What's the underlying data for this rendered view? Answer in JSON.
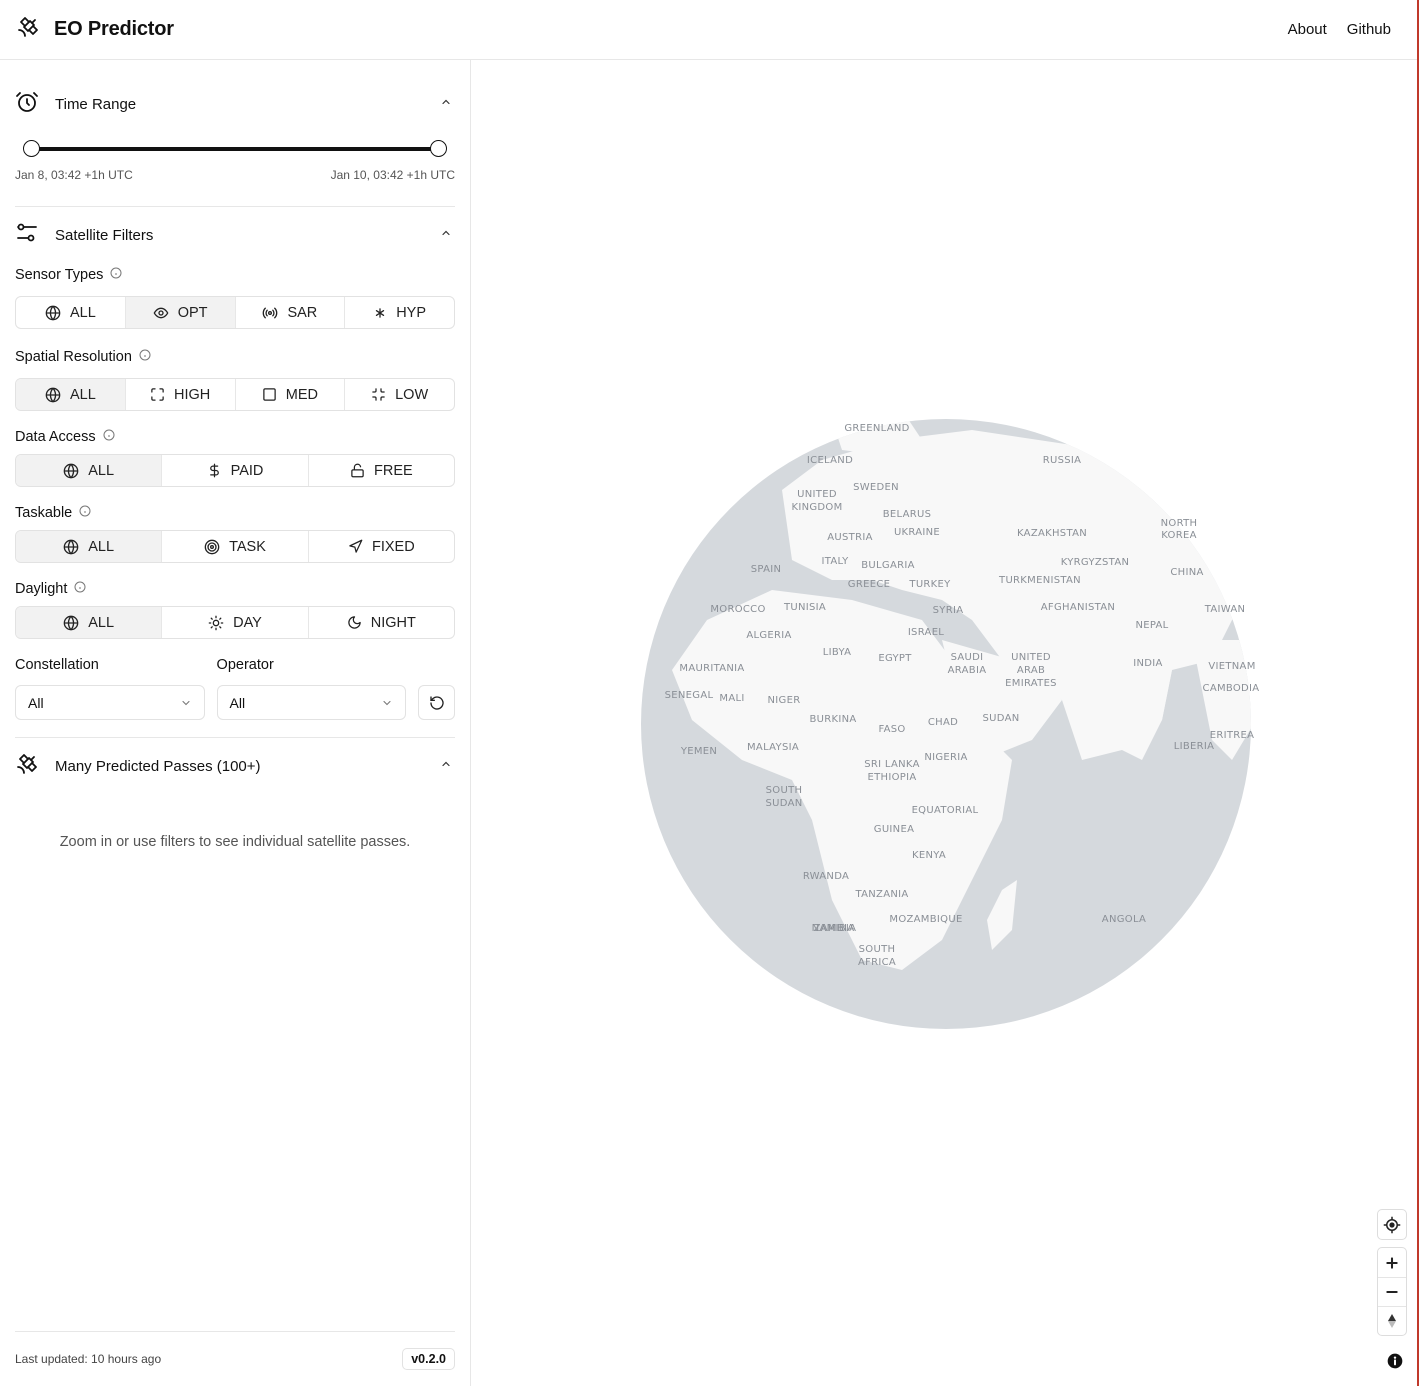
{
  "header": {
    "title": "EO Predictor",
    "nav": {
      "about": "About",
      "github": "Github"
    }
  },
  "time_range": {
    "title": "Time Range",
    "start_label": "Jan 8, 03:42 +1h UTC",
    "end_label": "Jan 10, 03:42 +1h UTC",
    "start_fraction": 0.0,
    "end_fraction": 1.0
  },
  "filters": {
    "title": "Satellite Filters",
    "sensor_types": {
      "label": "Sensor Types",
      "options": [
        "ALL",
        "OPT",
        "SAR",
        "HYP"
      ],
      "active": "OPT"
    },
    "spatial_resolution": {
      "label": "Spatial Resolution",
      "options": [
        "ALL",
        "HIGH",
        "MED",
        "LOW"
      ],
      "active": "ALL"
    },
    "data_access": {
      "label": "Data Access",
      "options": [
        "ALL",
        "PAID",
        "FREE"
      ],
      "active": "ALL"
    },
    "taskable": {
      "label": "Taskable",
      "options": [
        "ALL",
        "TASK",
        "FIXED"
      ],
      "active": "ALL"
    },
    "daylight": {
      "label": "Daylight",
      "options": [
        "ALL",
        "DAY",
        "NIGHT"
      ],
      "active": "ALL"
    },
    "constellation": {
      "label": "Constellation",
      "value": "All"
    },
    "operator": {
      "label": "Operator",
      "value": "All"
    }
  },
  "passes": {
    "title": "Many Predicted Passes (100+)",
    "hint": "Zoom in or use filters to see individual satellite passes."
  },
  "footer": {
    "last_updated": "Last updated: 10 hours ago",
    "version": "v0.2.0"
  },
  "map": {
    "labels": [
      "GREENLAND",
      "ICELAND",
      "RUSSIA",
      "UNITED",
      "KINGDOM",
      "SWEDEN",
      "BELARUS",
      "UKRAINE",
      "AUSTRIA",
      "KAZAKHSTAN",
      "NORTH",
      "KOREA",
      "KYRGYZSTAN",
      "SPAIN",
      "ITALY",
      "BULGARIA",
      "TURKMENISTAN",
      "CHINA",
      "GREECE",
      "TURKEY",
      "MOROCCO",
      "TUNISIA",
      "SYRIA",
      "AFGHANISTAN",
      "TAIWAN",
      "ALGERIA",
      "ISRAEL",
      "NEPAL",
      "LIBYA",
      "EGYPT",
      "SAUDI",
      "ARABIA",
      "UNITED",
      "ARAB",
      "EMIRATES",
      "INDIA",
      "VIETNAM",
      "MAURITANIA",
      "CAMBODIA",
      "SENEGAL",
      "MALI",
      "NIGER",
      "BURKINA",
      "FASO",
      "CHAD",
      "SUDAN",
      "ERITREA",
      "YEMEN",
      "MALAYSIA",
      "LIBERIA",
      "NIGERIA",
      "SRI LANKA",
      "ETHIOPIA",
      "SOUTH",
      "SUDAN",
      "EQUATORIAL",
      "GUINEA",
      "KENYA",
      "RWANDA",
      "TANZANIA",
      "ANGOLA",
      "ZAMBIA",
      "MOZAMBIQUE",
      "NAMIBIA",
      "SOUTH",
      "AFRICA"
    ],
    "colors": {
      "ocean": "#d5d9dd",
      "land": "#f8f8f8"
    }
  }
}
